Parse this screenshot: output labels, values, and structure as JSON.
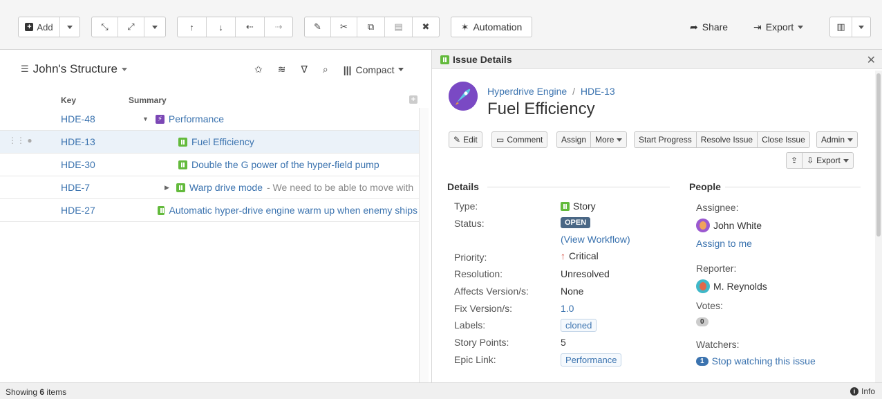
{
  "toolbar": {
    "add_label": "Add",
    "automation_label": "Automation",
    "share_label": "Share",
    "export_label": "Export"
  },
  "structure": {
    "title": "John's Structure",
    "view_label": "Compact",
    "columns": {
      "key": "Key",
      "summary": "Summary"
    },
    "rows": [
      {
        "key": "HDE-48",
        "summary": "Performance",
        "summary_extra": ""
      },
      {
        "key": "HDE-13",
        "summary": "Fuel Efficiency",
        "summary_extra": ""
      },
      {
        "key": "HDE-30",
        "summary": "Double the G power of the hyper-field pump",
        "summary_extra": ""
      },
      {
        "key": "HDE-7",
        "summary": "Warp drive mode",
        "summary_extra": "- We need to be able to move with"
      },
      {
        "key": "HDE-27",
        "summary": "Automatic hyper-drive engine warm up when enemy ships",
        "summary_extra": ""
      }
    ]
  },
  "details": {
    "panel_title": "Issue Details",
    "project": "Hyperdrive Engine",
    "separator": "/",
    "issue_key": "HDE-13",
    "title": "Fuel Efficiency",
    "actions": {
      "edit": "Edit",
      "comment": "Comment",
      "assign": "Assign",
      "more": "More",
      "start_progress": "Start Progress",
      "resolve": "Resolve Issue",
      "close": "Close Issue",
      "admin": "Admin",
      "export": "Export"
    },
    "section_details": "Details",
    "section_people": "People",
    "fields": {
      "type_label": "Type:",
      "type_value": "Story",
      "status_label": "Status:",
      "status_value": "OPEN",
      "workflow_link": "(View Workflow)",
      "priority_label": "Priority:",
      "priority_value": "Critical",
      "resolution_label": "Resolution:",
      "resolution_value": "Unresolved",
      "affects_label": "Affects Version/s:",
      "affects_value": "None",
      "fix_label": "Fix Version/s:",
      "fix_value": "1.0",
      "labels_label": "Labels:",
      "labels_value": "cloned",
      "points_label": "Story Points:",
      "points_value": "5",
      "epic_label": "Epic Link:",
      "epic_value": "Performance"
    },
    "people": {
      "assignee_label": "Assignee:",
      "assignee": "John White",
      "assign_to_me": "Assign to me",
      "reporter_label": "Reporter:",
      "reporter": "M. Reynolds",
      "votes_label": "Votes:",
      "votes_count": "0",
      "watchers_label": "Watchers:",
      "watchers_count": "1",
      "watch_link": "Stop watching this issue"
    }
  },
  "footer": {
    "showing_prefix": "Showing",
    "showing_count": "6",
    "showing_suffix": "items",
    "info_label": "Info"
  },
  "colors": {
    "link": "#3b73af",
    "story": "#63ba3c",
    "epic": "#7b47b5",
    "status": "#4a6785",
    "critical": "#d04437"
  }
}
